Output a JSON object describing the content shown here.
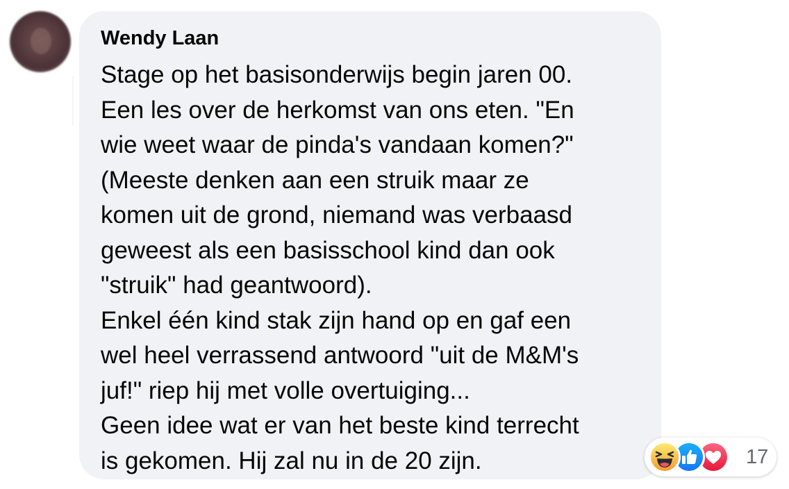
{
  "comment": {
    "author": "Wendy Laan",
    "text_lines": [
      "Stage op het basisonderwijs begin jaren 00.",
      "Een les over de herkomst van ons eten. \"En",
      "wie weet waar de pinda's vandaan komen?\"",
      "(Meeste denken aan een struik maar ze",
      "komen uit de grond, niemand was verbaasd",
      "geweest als een basisschool kind dan ook",
      "\"struik\" had geantwoord).",
      "Enkel één kind stak zijn hand op en gaf een",
      "wel heel verrassend antwoord \"uit de M&M's",
      "juf!\" riep hij met volle overtuiging...",
      "Geen idee wat er van het beste kind terrecht",
      "is gekomen. Hij zal nu in de 20 zijn."
    ]
  },
  "reactions": {
    "icons": [
      "haha-icon",
      "like-icon",
      "love-icon"
    ],
    "count": "17"
  },
  "colors": {
    "bubble_bg": "#f0f2f5",
    "text": "#050505",
    "count_text": "#65676b",
    "like_blue": "#1877f2",
    "love_red": "#f33e58",
    "haha_yellow": "#f7b125"
  }
}
